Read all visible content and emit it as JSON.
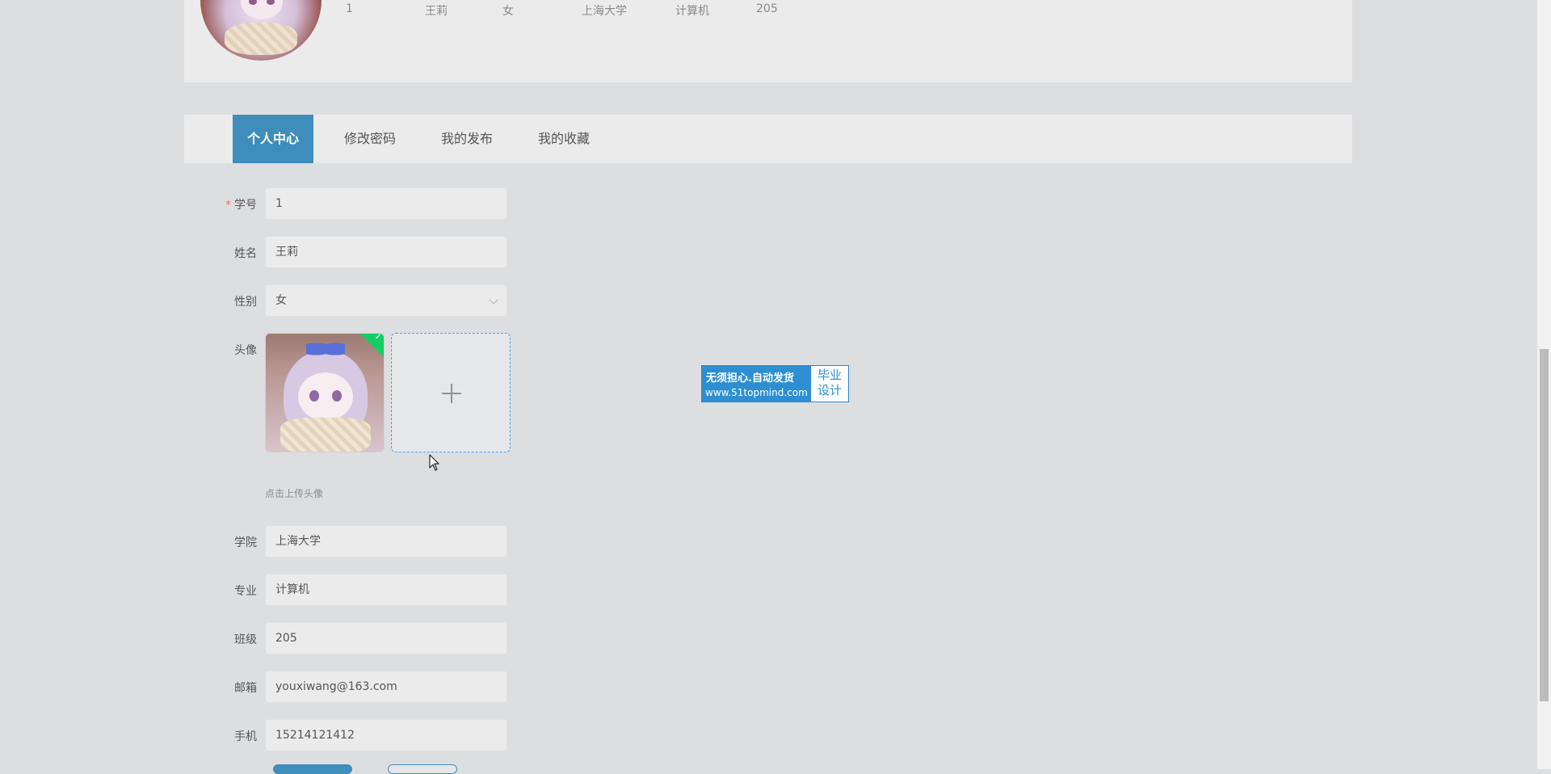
{
  "profile": {
    "student_no": "1",
    "name": "王莉",
    "gender": "女",
    "college": "上海大学",
    "major": "计算机",
    "class": "205"
  },
  "tabs": [
    {
      "label": "个人中心",
      "active": true
    },
    {
      "label": "修改密码",
      "active": false
    },
    {
      "label": "我的发布",
      "active": false
    },
    {
      "label": "我的收藏",
      "active": false
    }
  ],
  "form": {
    "student_no": {
      "label": "学号",
      "value": "1",
      "required": "*"
    },
    "name": {
      "label": "姓名",
      "value": "王莉"
    },
    "gender": {
      "label": "性别",
      "value": "女"
    },
    "avatar": {
      "label": "头像",
      "tip": "点击上传头像"
    },
    "college": {
      "label": "学院",
      "value": "上海大学"
    },
    "major": {
      "label": "专业",
      "value": "计算机"
    },
    "class": {
      "label": "班级",
      "value": "205"
    },
    "email": {
      "label": "邮箱",
      "value": "youxiwang@163.com"
    },
    "phone": {
      "label": "手机",
      "value": "15214121412"
    }
  },
  "ad": {
    "line1": "无须担心.自动发货",
    "line2": "www.51topmind.com",
    "right_top": "毕业",
    "right_bottom": "设计"
  },
  "icons": {
    "upload": "plus-icon",
    "gender_select": "chevron-down-icon",
    "upload_success": "check-icon",
    "cursor": "mouse-pointer-icon"
  },
  "colors": {
    "accent": "#3f8dbb",
    "required": "#f56c6c",
    "success": "#13ce66",
    "upload_border": "#409eff"
  }
}
